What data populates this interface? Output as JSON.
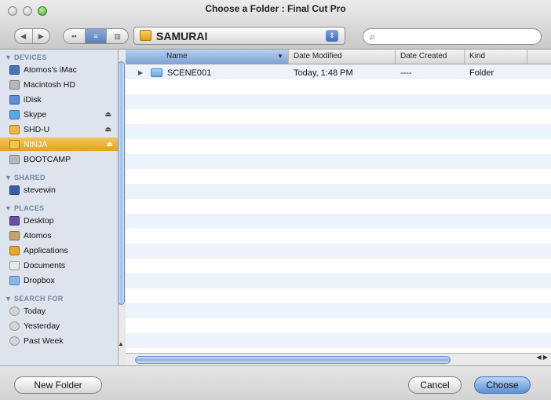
{
  "window": {
    "title": "Choose a Folder : Final Cut Pro"
  },
  "toolbar": {
    "back_glyph": "◀",
    "forward_glyph": "▶",
    "view_icons": "▪▪",
    "view_list": "≡",
    "view_columns": "▥",
    "path_label": "SAMURAI",
    "path_stepper": "⇕",
    "search_glyph": "🔍",
    "search_value": ""
  },
  "sidebar": {
    "devices_heading": "▼ DEVICES",
    "devices": [
      {
        "label": "Atomos's iMac",
        "icon": "imac-icon",
        "color": "#4a74b8"
      },
      {
        "label": "Macintosh HD",
        "icon": "hard-drive-icon",
        "color": "#b8b8b8"
      },
      {
        "label": "iDisk",
        "icon": "idisk-icon",
        "color": "#5b8fd6"
      },
      {
        "label": "Skype",
        "icon": "drive-icon",
        "color": "#57a9e8",
        "eject": "⏏"
      },
      {
        "label": "SHD-U",
        "icon": "drive-icon",
        "color": "#f0b646",
        "eject": "⏏"
      },
      {
        "label": "NINJA",
        "icon": "drive-icon",
        "color": "#f6c54d",
        "eject": "⏏",
        "selected": true
      },
      {
        "label": "BOOTCAMP",
        "icon": "hard-drive-icon",
        "color": "#b8b8b8"
      }
    ],
    "shared_heading": "▼ SHARED",
    "shared": [
      {
        "label": "stevewin",
        "icon": "network-computer-icon",
        "color": "#3a5fa6"
      }
    ],
    "places_heading": "▼ PLACES",
    "places": [
      {
        "label": "Desktop",
        "icon": "desktop-icon",
        "color": "#6b4da3"
      },
      {
        "label": "Atomos",
        "icon": "home-icon",
        "color": "#c5a36b"
      },
      {
        "label": "Applications",
        "icon": "applications-icon",
        "color": "#e7a72a"
      },
      {
        "label": "Documents",
        "icon": "documents-icon",
        "color": "#e9e9e9"
      },
      {
        "label": "Dropbox",
        "icon": "folder-icon",
        "color": "#8bb6e4"
      }
    ],
    "search_heading": "▼ SEARCH FOR",
    "search_for": [
      {
        "label": "Today",
        "icon": "clock-icon",
        "color": "#d5d5d5"
      },
      {
        "label": "Yesterday",
        "icon": "clock-icon",
        "color": "#d5d5d5"
      },
      {
        "label": "Past Week",
        "icon": "clock-icon",
        "color": "#d5d5d5"
      }
    ],
    "scroll_arrows": "▲▼"
  },
  "list": {
    "headers": {
      "name": "Name",
      "date_modified": "Date Modified",
      "date_created": "Date Created",
      "kind": "Kind",
      "sort_glyph": "▼"
    },
    "rows": [
      {
        "disclosure": "▶",
        "name": "SCENE001",
        "date_modified": "Today, 1:48 PM",
        "date_created": "----",
        "kind": "Folder"
      }
    ],
    "h_arrows": "◀ ▶"
  },
  "buttons": {
    "new_folder": "New Folder",
    "cancel": "Cancel",
    "choose": "Choose"
  }
}
